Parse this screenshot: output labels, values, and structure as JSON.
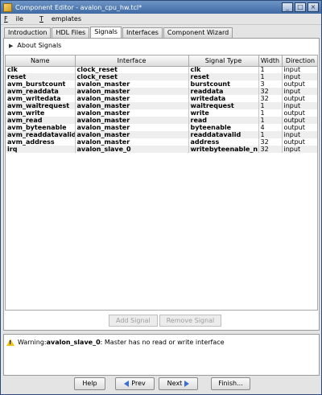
{
  "window": {
    "title": "Component Editor - avalon_cpu_hw.tcl*"
  },
  "menu": {
    "file": "File",
    "templates": "Templates",
    "file_mnemonic": "F",
    "file_rest": "ile",
    "templates_mnemonic": "T",
    "templates_rest": "emplates"
  },
  "tabs": [
    "Introduction",
    "HDL Files",
    "Signals",
    "Interfaces",
    "Component Wizard"
  ],
  "about_signals": "About Signals",
  "table": {
    "columns": [
      "Name",
      "Interface",
      "Signal Type",
      "Width",
      "Direction"
    ],
    "rows": [
      [
        "clk",
        "clock_reset",
        "clk",
        "1",
        "input"
      ],
      [
        "reset",
        "clock_reset",
        "reset",
        "1",
        "input"
      ],
      [
        "avm_burstcount",
        "avalon_master",
        "burstcount",
        "3",
        "output"
      ],
      [
        "avm_readdata",
        "avalon_master",
        "readdata",
        "32",
        "input"
      ],
      [
        "avm_writedata",
        "avalon_master",
        "writedata",
        "32",
        "output"
      ],
      [
        "avm_waitrequest",
        "avalon_master",
        "waitrequest",
        "1",
        "input"
      ],
      [
        "avm_write",
        "avalon_master",
        "write",
        "1",
        "output"
      ],
      [
        "avm_read",
        "avalon_master",
        "read",
        "1",
        "output"
      ],
      [
        "avm_byteenable",
        "avalon_master",
        "byteenable",
        "4",
        "output"
      ],
      [
        "avm_readdatavalid",
        "avalon_master",
        "readdatavalid",
        "1",
        "input"
      ],
      [
        "avm_address",
        "avalon_master",
        "address",
        "32",
        "output"
      ],
      [
        "irq",
        "avalon_slave_0",
        "writebyteenable_n",
        "32",
        "input"
      ]
    ]
  },
  "buttons": {
    "add_signal": "Add Signal",
    "remove_signal": "Remove Signal"
  },
  "message": {
    "prefix": "Warning: ",
    "interface": "avalon_slave_0",
    "text": ": Master has no read or write interface"
  },
  "footer": {
    "help": "Help",
    "prev": "Prev",
    "next": "Next",
    "finish": "Finish..."
  }
}
